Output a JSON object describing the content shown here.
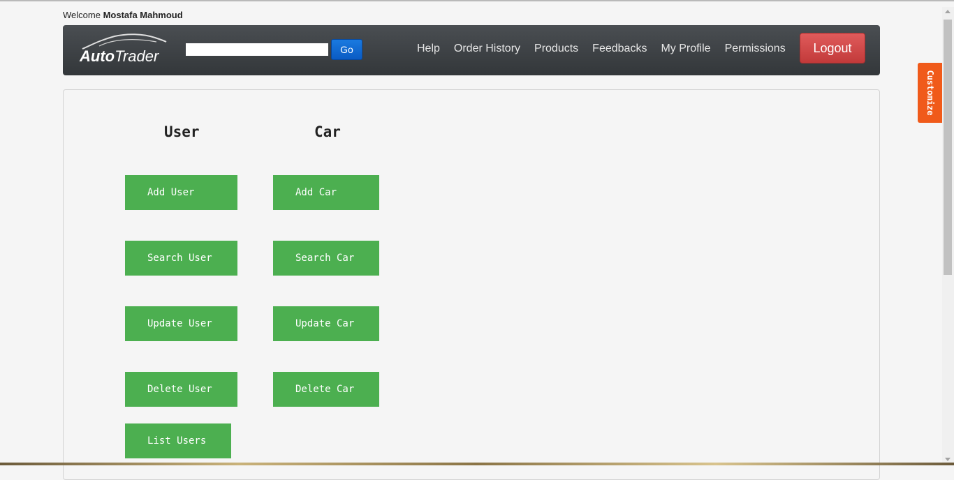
{
  "header": {
    "welcome_prefix": "Welcome",
    "user_name": "Mostafa Mahmoud"
  },
  "navbar": {
    "logo_word1": "Auto",
    "logo_word2": "Trader",
    "search_placeholder": "",
    "search_value": "",
    "go_label": "Go",
    "links": [
      "Help",
      "Order History",
      "Products",
      "Feedbacks",
      "My Profile",
      "Permissions"
    ],
    "logout_label": "Logout"
  },
  "main": {
    "user_col": {
      "title": "User",
      "buttons": [
        "Add User",
        "Search User",
        "Update User",
        "Delete User",
        "List Users"
      ]
    },
    "car_col": {
      "title": "Car",
      "buttons": [
        "Add Car",
        "Search Car",
        "Update Car",
        "Delete Car"
      ]
    }
  },
  "side_tab": {
    "label": "Customize"
  },
  "colors": {
    "navbar": "#3d4144",
    "go_button": "#0a64d0",
    "logout_button": "#d64a4a",
    "action_button": "#4caf50",
    "customize_tab": "#f05a1a"
  },
  "icons": [
    "car-outline-logo-icon",
    "scroll-up-arrow-icon",
    "scroll-down-arrow-icon"
  ]
}
